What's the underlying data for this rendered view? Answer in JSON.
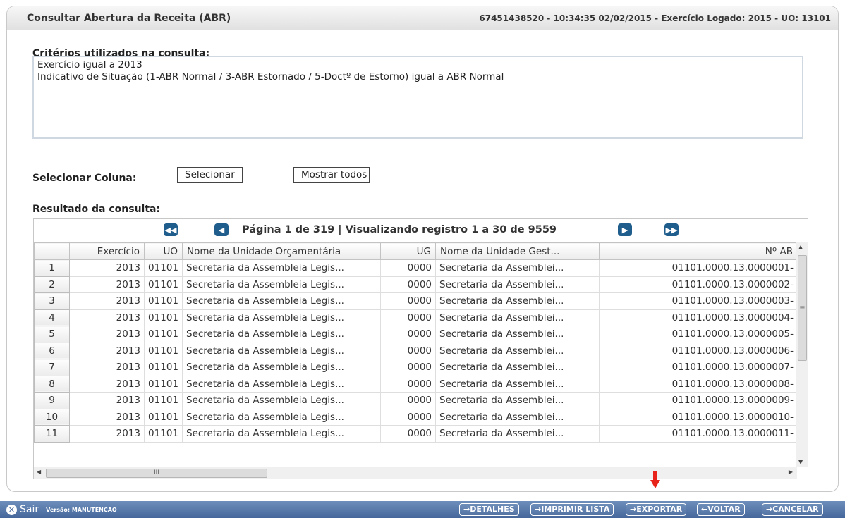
{
  "header": {
    "title": "Consultar Abertura da Receita (ABR)",
    "info": "67451438520 - 10:34:35 02/02/2015 - Exercício Logado: 2015 - UO: 13101"
  },
  "criteria": {
    "label": "Critérios utilizados na consulta:",
    "lines": [
      "Exercício igual a 2013",
      "Indicativo de Situação (1-ABR Normal / 3-ABR Estornado / 5-Doctº de Estorno) igual a ABR Normal"
    ]
  },
  "column_select": {
    "label": "Selecionar Coluna:",
    "select_button": "Selecionar",
    "show_all_button": "Mostrar todos"
  },
  "results": {
    "label": "Resultado da consulta:",
    "pager_text": "Página 1 de 319 | Visualizando registro 1 a 30 de 9559",
    "columns": [
      "Exercício",
      "UO",
      "Nome da Unidade Orçamentária",
      "UG",
      "Nome da Unidade Gest...",
      "Nº AB"
    ],
    "rows": [
      [
        "1",
        "2013",
        "01101",
        "Secretaria da Assembleia Legis...",
        "0000",
        "Secretaria da Assemblei...",
        "01101.0000.13.0000001-"
      ],
      [
        "2",
        "2013",
        "01101",
        "Secretaria da Assembleia Legis...",
        "0000",
        "Secretaria da Assemblei...",
        "01101.0000.13.0000002-"
      ],
      [
        "3",
        "2013",
        "01101",
        "Secretaria da Assembleia Legis...",
        "0000",
        "Secretaria da Assemblei...",
        "01101.0000.13.0000003-"
      ],
      [
        "4",
        "2013",
        "01101",
        "Secretaria da Assembleia Legis...",
        "0000",
        "Secretaria da Assemblei...",
        "01101.0000.13.0000004-"
      ],
      [
        "5",
        "2013",
        "01101",
        "Secretaria da Assembleia Legis...",
        "0000",
        "Secretaria da Assemblei...",
        "01101.0000.13.0000005-"
      ],
      [
        "6",
        "2013",
        "01101",
        "Secretaria da Assembleia Legis...",
        "0000",
        "Secretaria da Assemblei...",
        "01101.0000.13.0000006-"
      ],
      [
        "7",
        "2013",
        "01101",
        "Secretaria da Assembleia Legis...",
        "0000",
        "Secretaria da Assemblei...",
        "01101.0000.13.0000007-"
      ],
      [
        "8",
        "2013",
        "01101",
        "Secretaria da Assembleia Legis...",
        "0000",
        "Secretaria da Assemblei...",
        "01101.0000.13.0000008-"
      ],
      [
        "9",
        "2013",
        "01101",
        "Secretaria da Assembleia Legis...",
        "0000",
        "Secretaria da Assemblei...",
        "01101.0000.13.0000009-"
      ],
      [
        "10",
        "2013",
        "01101",
        "Secretaria da Assembleia Legis...",
        "0000",
        "Secretaria da Assemblei...",
        "01101.0000.13.0000010-"
      ],
      [
        "11",
        "2013",
        "01101",
        "Secretaria da Assembleia Legis...",
        "0000",
        "Secretaria da Assemblei...",
        "01101.0000.13.0000011-"
      ]
    ]
  },
  "footer": {
    "sair": "Sair",
    "versao": "Versão: MANUTENCAO",
    "buttons": [
      "→DETALHES",
      "→IMPRIMIR LISTA",
      "→EXPORTAR",
      "←VOLTAR",
      "→CANCELAR"
    ]
  },
  "colors": {
    "footer_bar": "#44669a",
    "pager_button": "#1f5d8c",
    "annotation_arrow": "#e8231a"
  }
}
